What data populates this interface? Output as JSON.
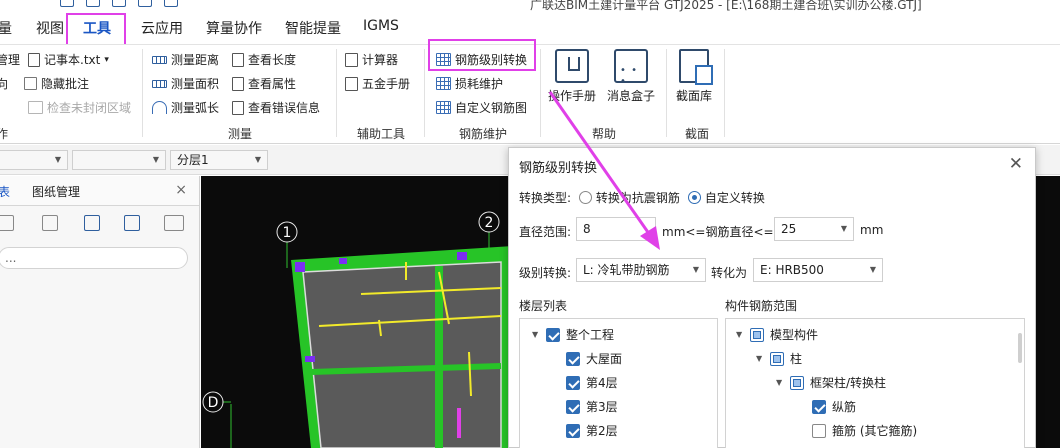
{
  "title_bar": {
    "text": "广联达BIM土建计量平台 GTJ2025 - [E:\\168期土建合班\\实训办公楼.GTJ]"
  },
  "ribbon_tabs": [
    {
      "label": "量"
    },
    {
      "label": "视图"
    },
    {
      "label": "工具",
      "active": true
    },
    {
      "label": "云应用"
    },
    {
      "label": "算量协作"
    },
    {
      "label": "智能提量"
    },
    {
      "label": "IGMS"
    }
  ],
  "ribbon": {
    "left_partial": {
      "label_1": "管理",
      "label_2": "向",
      "group": "作"
    },
    "notepad": {
      "label": "记事本.txt",
      "arrow": "▾"
    },
    "hide_comments": {
      "label": "隐藏批注"
    },
    "check_unclosed": {
      "label": "检查未封闭区域"
    },
    "measure": {
      "distance": "测量距离",
      "area": "测量面积",
      "arc": "测量弧长",
      "view_length": "查看长度",
      "view_props": "查看属性",
      "view_errors": "查看错误信息",
      "group": "测量"
    },
    "aux": {
      "calculator": "计算器",
      "hardware": "五金手册",
      "group": "辅助工具"
    },
    "rebar_maint": {
      "grade_convert": "钢筋级别转换",
      "loss": "损耗维护",
      "custom_rebar": "自定义钢筋图",
      "group": "钢筋维护"
    },
    "help": {
      "manual": "操作手册",
      "message_box": "消息盒子",
      "group": "帮助"
    },
    "section": {
      "library": "截面库",
      "group": "截面"
    }
  },
  "toolbar": {
    "layer_value": "分层1"
  },
  "left_panel": {
    "tab_partial": "表",
    "tab_drawing": "图纸管理",
    "close": "×",
    "search_placeholder": "..."
  },
  "canvas": {
    "axis_1": "1",
    "axis_2": "2",
    "axis_D": "D"
  },
  "dialog": {
    "title": "钢筋级别转换",
    "close": "✕",
    "convert_type_label": "转换类型:",
    "option_seismic": "转换为抗震钢筋",
    "option_custom": "自定义转换",
    "diameter_label": "直径范围:",
    "diameter_min": "8",
    "diameter_mid": "mm<=钢筋直径<=",
    "diameter_max": "25",
    "diameter_unit": "mm",
    "grade_label": "级别转换:",
    "grade_from": "L: 冷轧带肋钢筋",
    "convert_to_label": "转化为",
    "grade_to": "E: HRB500",
    "floor_list_label": "楼层列表",
    "component_range_label": "构件钢筋范围",
    "floors": [
      {
        "label": "整个工程"
      },
      {
        "label": "大屋面"
      },
      {
        "label": "第4层"
      },
      {
        "label": "第3层"
      },
      {
        "label": "第2层"
      }
    ],
    "components": [
      {
        "label": "模型构件"
      },
      {
        "label": "柱"
      },
      {
        "label": "框架柱/转换柱"
      },
      {
        "label": "纵筋"
      },
      {
        "label": "箍筋 (其它箍筋)"
      }
    ]
  },
  "colors": {
    "accent": "#1a56c4",
    "highlight": "#e040e8",
    "canvas_bg": "#0b0b0b",
    "slab_green": "#27c427",
    "slab_fill": "#5a5a5a",
    "rebar_yellow": "#f2ea2a"
  }
}
